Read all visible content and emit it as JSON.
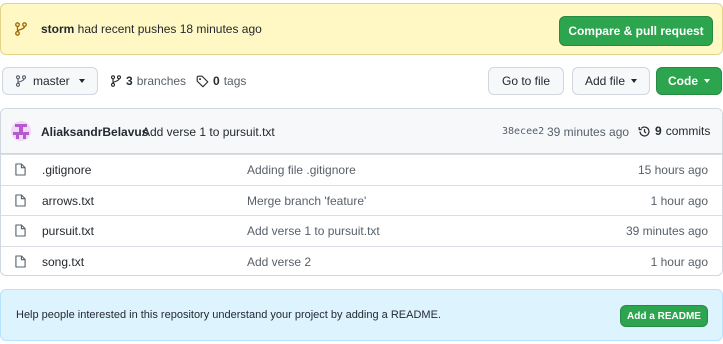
{
  "banner": {
    "user": "storm",
    "message": " had recent pushes 18 minutes ago",
    "button": "Compare & pull request"
  },
  "toolbar": {
    "branch": "master",
    "branches_count": "3",
    "branches_label": "branches",
    "tags_count": "0",
    "tags_label": "tags",
    "go_to_file": "Go to file",
    "add_file": "Add file",
    "code": "Code"
  },
  "latest_commit": {
    "author": "AliaksandrBelavus",
    "message": "Add verse 1 to pursuit.txt",
    "sha": "38ecee2",
    "time": "39 minutes ago",
    "commits_count": "9",
    "commits_label": "commits"
  },
  "files": [
    {
      "name": ".gitignore",
      "message": "Adding file .gitignore",
      "age": "15 hours ago"
    },
    {
      "name": "arrows.txt",
      "message": "Merge branch 'feature'",
      "age": "1 hour ago"
    },
    {
      "name": "pursuit.txt",
      "message": "Add verse 1 to pursuit.txt",
      "age": "39 minutes ago"
    },
    {
      "name": "song.txt",
      "message": "Add verse 2",
      "age": "1 hour ago"
    }
  ],
  "readme": {
    "message": "Help people interested in this repository understand your project by adding a README.",
    "button": "Add a README"
  },
  "colors": {
    "banner_bg": "#fff8c5",
    "primary_green": "#2da44e",
    "readme_bg": "#ddf4ff"
  }
}
